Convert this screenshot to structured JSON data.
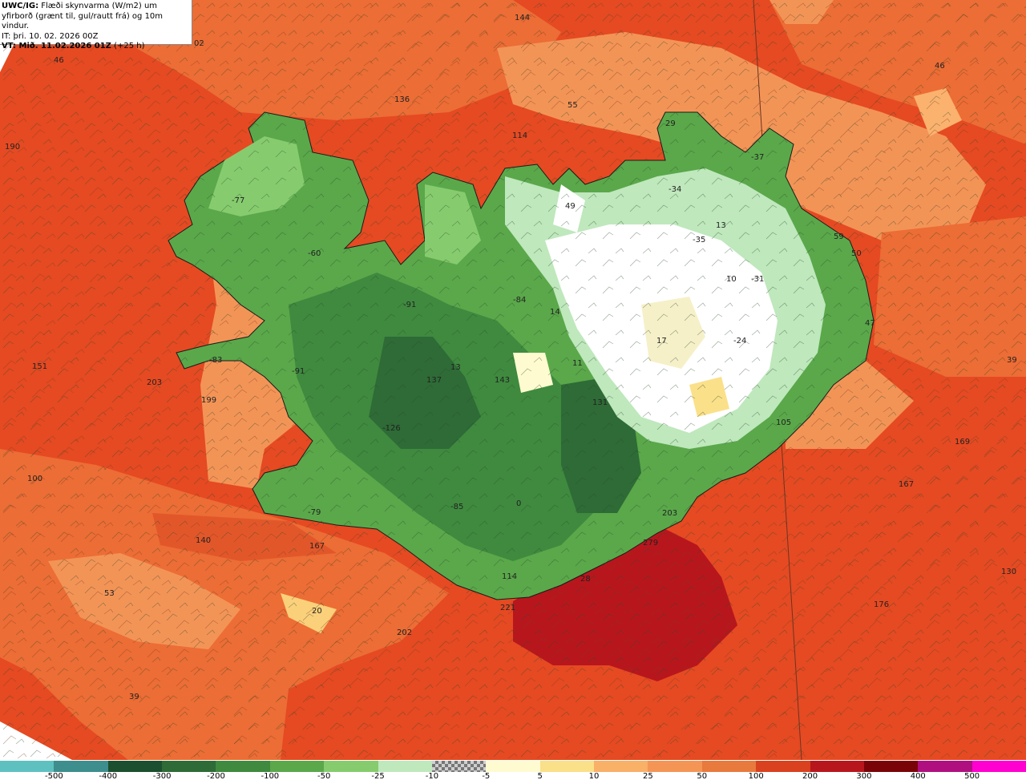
{
  "info": {
    "line1_bold": "UWC/IG:",
    "line1_rest": " Flæði skynvarma (W/m2) um",
    "line2": "yfirborð (grænt til, gul/rautt frá) og 10m vindur.",
    "line3": "IT: þri. 10. 02. 2026 00Z",
    "line4_bold": "VT: Mið. 11.02.2026 01Z",
    "line4_rest": " (+25 h)"
  },
  "map_labels": [
    "144",
    "02",
    "46",
    "136",
    "55",
    "114",
    "190",
    "46",
    "29",
    "-37",
    "-34",
    "49",
    "-77",
    "13",
    "-35",
    "59",
    "50",
    "-60",
    "10",
    "-31",
    "-91",
    "-84",
    "14",
    "47",
    "17",
    "-24",
    "39",
    "-83",
    "-91",
    "151",
    "137",
    "13",
    "143",
    "11",
    "203",
    "199",
    "131",
    "105",
    "169",
    "-126",
    "100",
    "167",
    "-79",
    "-85",
    "0",
    "203",
    "140",
    "167",
    "279",
    "130",
    "53",
    "114",
    "28",
    "176",
    "20",
    "221",
    "202",
    "39"
  ],
  "colorbar": {
    "colors": [
      "#5fc0c0",
      "#3e8e8e",
      "#1b4f2f",
      "#2e6b36",
      "#3f8a3f",
      "#5aa84a",
      "#86cc6e",
      "#bfe8bd",
      "checker",
      "#fffbd0",
      "#fbe08a",
      "#f9b067",
      "#f49556",
      "#e87a3d",
      "#d9411f",
      "#b8161d",
      "#7a0308",
      "#b0107f",
      "#ff00d0"
    ],
    "ticks": [
      "-500",
      "-400",
      "-300",
      "-200",
      "-100",
      "-50",
      "-25",
      "-10",
      "-5",
      "5",
      "10",
      "25",
      "50",
      "100",
      "200",
      "300",
      "400",
      "500"
    ]
  }
}
